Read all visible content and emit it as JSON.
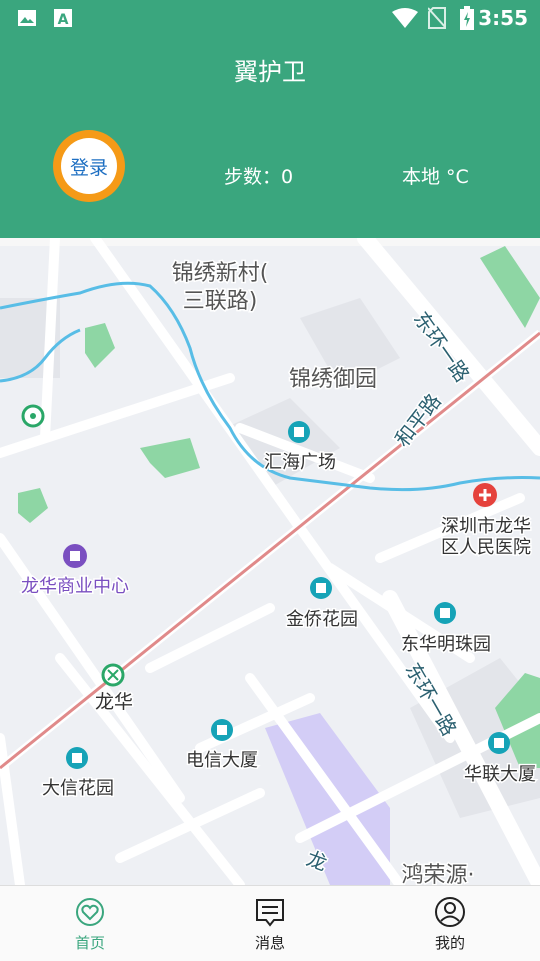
{
  "status_bar": {
    "time": "3:55"
  },
  "header": {
    "title": "翼护卫",
    "login_label": "登录",
    "steps": "步数：0",
    "location_temp": "本地  °C"
  },
  "map": {
    "labels": {
      "jinxiu_xincun": "锦绣新村(",
      "jinxiu_xincun2": "三联路)",
      "jinxiu_yuyuan": "锦绣御园",
      "donghuan_yilu_top": "东环一路",
      "heping_lu": "和平路",
      "huihai": "汇海广场",
      "hospital1": "深圳市龙华",
      "hospital2": "区人民医院",
      "longhua_business": "龙华商业中心",
      "jinqiao": "金侨花园",
      "donghua_mingzhu": "东华明珠园",
      "donghuan_yilu_bottom": "东环一路",
      "longhua": "龙华",
      "dianxin": "电信大厦",
      "dongxin": "大信花园",
      "hualian": "华联大厦",
      "hongrongyuan": "鸿荣源·",
      "long": "龙"
    }
  },
  "tabs": [
    {
      "label": "首页",
      "active": true
    },
    {
      "label": "消息",
      "active": false
    },
    {
      "label": "我的",
      "active": false
    }
  ],
  "colors": {
    "brand_green": "#3aa67e",
    "login_orange": "#f59a17",
    "poi_teal": "#16a3b7",
    "poi_purple": "#7a4fc0",
    "hospital_red": "#e5423c"
  }
}
